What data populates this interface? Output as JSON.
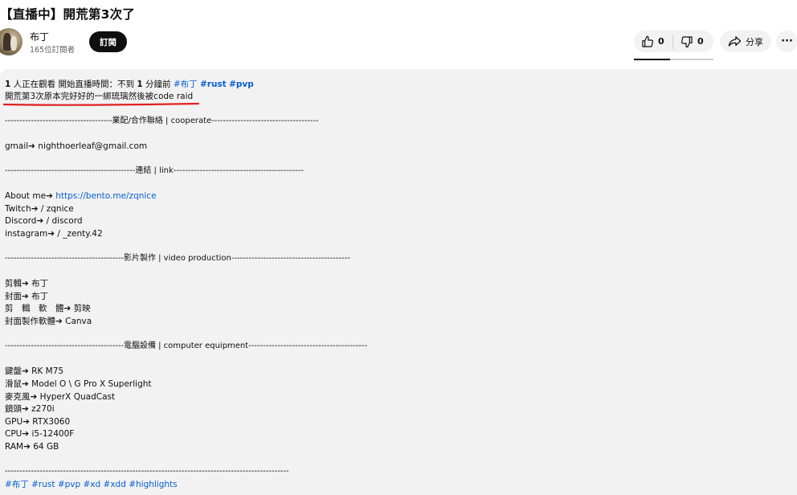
{
  "video": {
    "title": "【直播中】開荒第3次了"
  },
  "owner": {
    "channel_name": "布丁",
    "subscribers": "165位訂閱者",
    "subscribe_label": "訂閱"
  },
  "actions": {
    "like_count": "0",
    "dislike_count": "0",
    "share_label": "分享",
    "more_label": "···"
  },
  "description": {
    "viewers_count": "1",
    "viewers_text": " 人正在觀看  開始直播時間：不到 ",
    "start_minutes": "1",
    "start_suffix": " 分鐘前  ",
    "meta_hashtags": [
      "#布丁",
      "#rust",
      "#pvp"
    ],
    "headline": "開荒第3次原本完好好的一綁琉璃然後被code raid",
    "divider_business": "-------------------------------------業配/合作聯絡 | cooperate-------------------------------------",
    "gmail_line": "gmail➔ nighthoerleaf@gmail.com",
    "divider_link": "---------------------------------------------連結 | link---------------------------------------------",
    "about_label": "About me➔ ",
    "about_url": "https://bento.me/zqnice",
    "twitch_line": "Twitch➔   / zqnice",
    "discord_line": "Discord➔   / discord",
    "instagram_line": "instagram➔   / _zenty.42",
    "divider_video": "-----------------------------------------影片製作 | video production-----------------------------------------",
    "editing_line": "剪輯➔ 布丁",
    "cover_line": "封面➔ 布丁",
    "software_line": "剪　輯　軟　體➔ 剪映",
    "cover_software_line": "封面製作軟體➔ Canva",
    "divider_equipment": "-----------------------------------------電腦設備 | computer equipment-----------------------------------------",
    "keyboard_line": "鍵盤➔ RK M75",
    "mouse_line": "滑鼠➔ Model O \\ G Pro X Superlight",
    "mic_line": "麥克風➔ HyperX QuadCast",
    "camera_line": "鏡頭➔ z270i",
    "gpu_line": "GPU➔ RTX3060",
    "cpu_line": "CPU➔ i5-12400F",
    "ram_line": "RAM➔ 64 GB",
    "divider_end": "--------------------------------------------------------------------------------------------------",
    "footer_hashtags": "#布丁 #rust #pvp #xd #xdd #highlights"
  },
  "colors": {
    "accent_link": "#065fd4",
    "underline_annotation": "#e02020",
    "subscribe_bg": "#0f0f0f",
    "panel_bg": "#f2f2f2"
  }
}
